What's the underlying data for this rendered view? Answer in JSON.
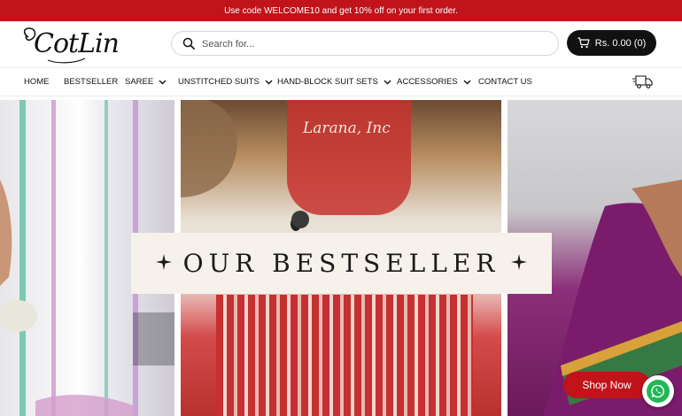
{
  "announcement": {
    "text": "Use code WELCOME10 and get 10% off on your first order."
  },
  "header": {
    "logo_text": "CotLin",
    "search": {
      "placeholder": "Search for...",
      "value": "",
      "icon": "search-icon"
    },
    "cart": {
      "label": "Rs. 0.00 (0)",
      "icon": "cart-icon"
    }
  },
  "nav": {
    "items": [
      {
        "label": "HOME",
        "dropdown": false
      },
      {
        "label": "BESTSELLER",
        "dropdown": false
      },
      {
        "label": "SAREE",
        "dropdown": true
      },
      {
        "label": "UNSTITCHED SUITS",
        "dropdown": true
      },
      {
        "label": "HAND-BLOCK SUIT SETS",
        "dropdown": true
      },
      {
        "label": "ACCESSORIES",
        "dropdown": true
      },
      {
        "label": "CONTACT US",
        "dropdown": false
      }
    ],
    "shipping_icon": "truck-icon"
  },
  "hero": {
    "banner_title": "OUR BESTSELLER",
    "signature": "Larana, Inc"
  },
  "floating": {
    "shop_now": "Shop Now",
    "whatsapp_icon": "whatsapp-icon"
  },
  "colors": {
    "brand_red": "#c0131a",
    "dark": "#111111",
    "banner_bg": "#f6f1ea"
  }
}
